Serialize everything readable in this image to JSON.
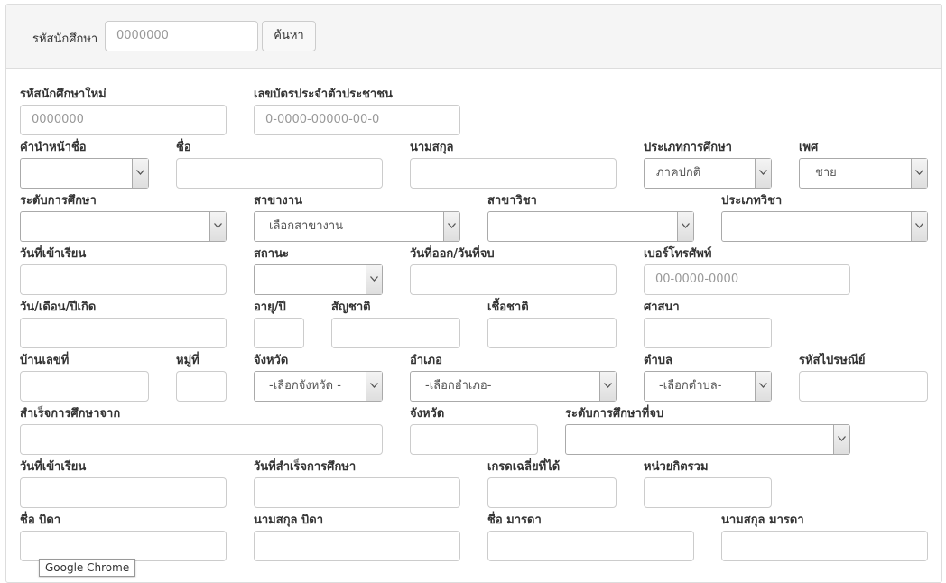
{
  "search": {
    "label": "รหัสนักศึกษา",
    "placeholder": "0000000",
    "button": "ค้นหา"
  },
  "form": {
    "student_id_new": {
      "label": "รหัสนักศึกษาใหม่",
      "placeholder": "0000000"
    },
    "citizen_id": {
      "label": "เลขบัตรประจำตัวประชาชน",
      "placeholder": "0-0000-00000-00-0"
    },
    "prefix": {
      "label": "คำนำหน้าชื่อ",
      "value": ""
    },
    "first_name": {
      "label": "ชื่อ"
    },
    "last_name": {
      "label": "นามสกุล"
    },
    "study_type": {
      "label": "ประเภทการศึกษา",
      "value": "ภาคปกติ"
    },
    "gender": {
      "label": "เพศ",
      "value": "ชาย"
    },
    "education_level": {
      "label": "ระดับการศึกษา",
      "value": ""
    },
    "department": {
      "label": "สาขางาน",
      "value": "เลือกสาขางาน"
    },
    "major": {
      "label": "สาขาวิชา",
      "value": ""
    },
    "subject_type": {
      "label": "ประเภทวิชา",
      "value": ""
    },
    "enroll_date": {
      "label": "วันที่เข้าเรียน"
    },
    "status": {
      "label": "สถานะ",
      "value": ""
    },
    "leave_date": {
      "label": "วันที่ออก/วันที่จบ"
    },
    "phone": {
      "label": "เบอร์โทรศัพท์",
      "placeholder": "00-0000-0000"
    },
    "birth_date": {
      "label": "วัน/เดือน/ปีเกิด"
    },
    "age": {
      "label": "อายุ/ปี"
    },
    "nationality": {
      "label": "สัญชาติ"
    },
    "ethnicity": {
      "label": "เชื้อชาติ"
    },
    "religion": {
      "label": "ศาสนา"
    },
    "house_no": {
      "label": "บ้านเลขที่"
    },
    "village_no": {
      "label": "หมู่ที่"
    },
    "province": {
      "label": "จังหวัด",
      "value": "-เลือกจังหวัด -"
    },
    "district": {
      "label": "อำเภอ",
      "value": "-เลือกอำเภอ-"
    },
    "subdistrict": {
      "label": "ตำบล",
      "value": "-เลือกตำบล-"
    },
    "postal_code": {
      "label": "รหัสไปรษณีย์"
    },
    "graduated_from": {
      "label": "สำเร็จการศึกษาจาก"
    },
    "grad_province": {
      "label": "จังหวัด"
    },
    "grad_level": {
      "label": "ระดับการศึกษาที่จบ",
      "value": ""
    },
    "enroll_date2": {
      "label": "วันที่เข้าเรียน"
    },
    "grad_date": {
      "label": "วันที่สำเร็จการศึกษา"
    },
    "gpa": {
      "label": "เกรดเฉลี่ยที่ได้"
    },
    "total_credits": {
      "label": "หน่วยกิตรวม"
    },
    "father_name": {
      "label": "ชื่อ บิดา"
    },
    "father_last_name": {
      "label": "นามสกุล บิดา"
    },
    "mother_name": {
      "label": "ชื่อ มารดา"
    },
    "mother_last_name": {
      "label": "นามสกุล มารดา"
    }
  },
  "tooltip": "Google Chrome"
}
